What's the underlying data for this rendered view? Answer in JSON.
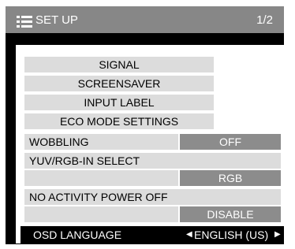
{
  "header": {
    "title": "SET UP",
    "page": "1/2"
  },
  "menu": {
    "signal": "SIGNAL",
    "screensaver": "SCREENSAVER",
    "input_label": "INPUT LABEL",
    "eco_mode": "ECO MODE SETTINGS",
    "wobbling": {
      "label": "WOBBLING",
      "value": "OFF"
    },
    "yuv_rgb": {
      "label": "YUV/RGB-IN SELECT",
      "value": "RGB"
    },
    "no_activity": {
      "label": "NO ACTIVITY POWER OFF",
      "value": "DISABLE"
    },
    "osd_language": {
      "label": "OSD LANGUAGE",
      "value": "ENGLISH (US)"
    }
  },
  "colors": {
    "header_bg": "#878787",
    "row_bg": "#dcdcdc",
    "value_bg": "#8c8c8c",
    "selected_bg": "#000000"
  }
}
